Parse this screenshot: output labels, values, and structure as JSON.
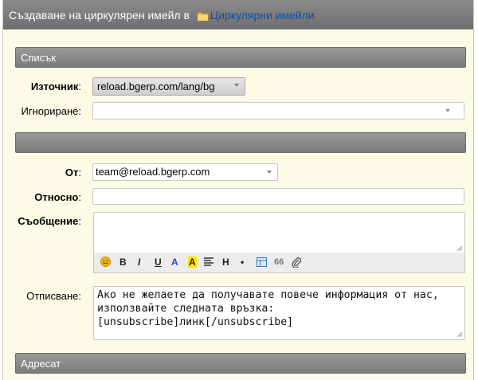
{
  "title": {
    "prefix": "Създаване на циркулярен имейл в",
    "folder_link": "Циркулярни имейли"
  },
  "sections": {
    "list": "Списък",
    "middle": "",
    "recipient": "Адресат"
  },
  "form": {
    "source": {
      "label": "Източник",
      "value": "reload.bgerp.com/lang/bg"
    },
    "ignore": {
      "label": "Игнориране",
      "value": ""
    },
    "from": {
      "label": "От",
      "value": "team@reload.bgerp.com"
    },
    "subject": {
      "label": "Относно",
      "value": ""
    },
    "message": {
      "label": "Съобщение",
      "value": ""
    },
    "unsubscribe": {
      "label": "Отписване",
      "value": "Ако не желаете да получавате повече информация от нас, използвайте следната връзка: [unsubscribe]линк[/unsubscribe]"
    }
  },
  "toolbar": {
    "bold": "B",
    "italic": "I",
    "underline": "U",
    "text_color": "A",
    "highlight": "A",
    "heading": "H",
    "bullet": "•",
    "quote": "66",
    "icons": [
      "smiley-icon",
      "align-icon",
      "table-icon",
      "paperclip-icon"
    ]
  },
  "colors": {
    "titlebar": "#7d7d7d",
    "form_background": "#fcfbe6",
    "link": "#0f4fa8",
    "text_color_button": "#1a4fd6",
    "highlight_button": "#ffe600"
  }
}
